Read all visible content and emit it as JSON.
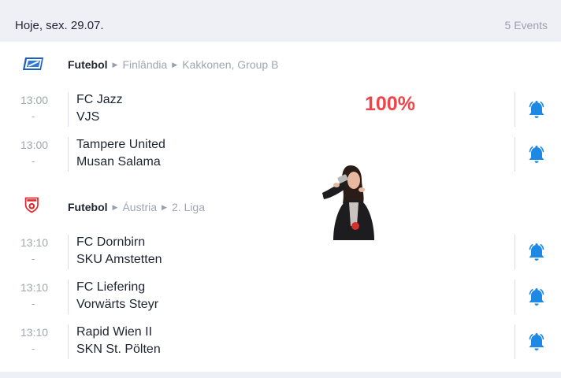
{
  "header": {
    "date": "Hoje, sex. 29.07.",
    "event_count": "5 Events"
  },
  "groups": [
    {
      "sport": "Futebol",
      "country": "Finlândia",
      "league": "Kakkonen, Group B",
      "matches": [
        {
          "time": "13:00",
          "status": "-",
          "home": "FC Jazz",
          "away": "VJS"
        },
        {
          "time": "13:00",
          "status": "-",
          "home": "Tampere United",
          "away": "Musan Salama"
        }
      ]
    },
    {
      "sport": "Futebol",
      "country": "Áustria",
      "league": "2. Liga",
      "matches": [
        {
          "time": "13:10",
          "status": "-",
          "home": "FC Dornbirn",
          "away": "SKU Amstetten"
        },
        {
          "time": "13:10",
          "status": "-",
          "home": "FC Liefering",
          "away": "Vorwärts Steyr"
        },
        {
          "time": "13:10",
          "status": "-",
          "home": "Rapid Wien II",
          "away": "SKN St. Pölten"
        }
      ]
    }
  ],
  "overlay": {
    "percent": "100%"
  },
  "colors": {
    "bell": "#1e88e5",
    "accent_red": "#f0444a",
    "background": "#eef0f5"
  },
  "icons": {
    "bell": "bell-icon",
    "league_finland": "finland-league-logo-icon",
    "league_austria": "austria-league-logo-icon"
  }
}
